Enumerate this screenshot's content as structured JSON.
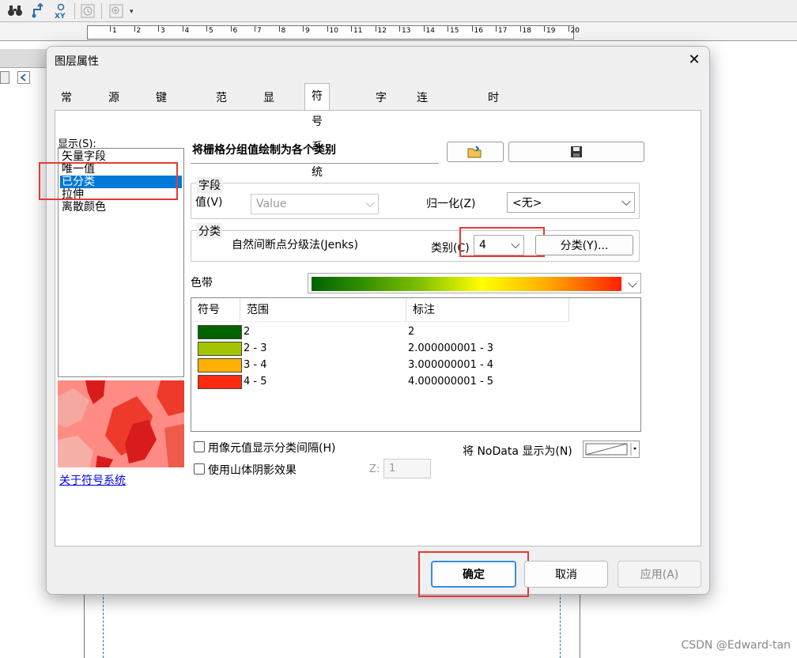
{
  "dialog": {
    "title": "图层属性",
    "close_glyph": "✕"
  },
  "tabs": [
    {
      "label": "常规"
    },
    {
      "label": "源"
    },
    {
      "label": "键元数据"
    },
    {
      "label": "范围"
    },
    {
      "label": "显示"
    },
    {
      "label": "符号系统",
      "active": true
    },
    {
      "label": "字段"
    },
    {
      "label": "连接和关联"
    },
    {
      "label": "时间"
    }
  ],
  "show": {
    "label": "显示(S):",
    "items": [
      {
        "label": "矢量字段"
      },
      {
        "label": "唯一值"
      },
      {
        "label": "已分类",
        "selected": true
      },
      {
        "label": "拉伸"
      },
      {
        "label": "离散颜色"
      }
    ]
  },
  "about_link": "关于符号系统",
  "heading": "将栅格分组值绘制为各个类别",
  "field_group": {
    "title": "字段",
    "value_label": "值(V)",
    "value_selected": "Value",
    "normalize_label": "归一化(Z)",
    "normalize_selected": "<无>"
  },
  "classification": {
    "title": "分类",
    "method": "自然间断点分级法(Jenks)",
    "classes_label": "类别(C)",
    "classes_value": "4",
    "classify_button": "分类(Y)..."
  },
  "color_ramp_label": "色带",
  "table": {
    "headers": [
      "符号",
      "范围",
      "标注"
    ],
    "rows": [
      {
        "color": "#006400",
        "range": "2",
        "label": "2"
      },
      {
        "color": "#a5c400",
        "range": "2 - 3",
        "label": "2.000000001 - 3"
      },
      {
        "color": "#ffb000",
        "range": "3 - 4",
        "label": "3.000000001 - 4"
      },
      {
        "color": "#ff2a10",
        "range": "4 - 5",
        "label": "4.000000001 - 5"
      }
    ]
  },
  "options": {
    "show_class_breaks": "用像元值显示分类间隔(H)",
    "use_hillshade": "使用山体阴影效果",
    "z_label": "Z:",
    "z_value": "1",
    "nodata_label": "将 NoData 显示为(N)"
  },
  "buttons": {
    "ok": "确定",
    "cancel": "取消",
    "apply": "应用(A)"
  },
  "ruler_numbers": [
    "1",
    "2",
    "3",
    "4",
    "5",
    "6",
    "7",
    "8",
    "9",
    "10",
    "11",
    "12",
    "13",
    "14",
    "15",
    "16",
    "17",
    "18",
    "19",
    "20"
  ],
  "watermark": "CSDN @Edward-tan"
}
